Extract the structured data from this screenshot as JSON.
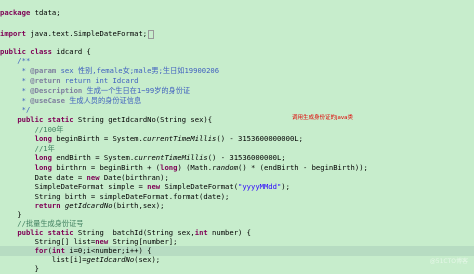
{
  "code": {
    "l01_kw": "package",
    "l01_rest": " tdata;",
    "l03_kw": "import",
    "l03_rest": " java.text.SimpleDateFormat;",
    "l05_kw1": "public",
    "l05_kw2": "class",
    "l05_rest": " idcard {",
    "l06": "    /**",
    "l07_star": "     * ",
    "l07_tag": "@param",
    "l07_text": " sex 性别,female女;male男;生日如19900206",
    "l08_star": "     * ",
    "l08_tag": "@return",
    "l08_text": " return int Idcard",
    "l09_star": "     * ",
    "l09_tag": "@Description",
    "l09_text": " 生成一个生日在1~99岁的身份证",
    "l10_star": "     * ",
    "l10_tag": "@useCase",
    "l10_text": " 生成人员的身份证信息",
    "l11": "     */",
    "l12_indent": "    ",
    "l12_kw1": "public",
    "l12_kw2": "static",
    "l12_rest": " String getIdcardNo(String sex){",
    "l13": "        //100年",
    "l14_indent": "        ",
    "l14_kw": "long",
    "l14_a": " beginBirth = System.",
    "l14_it": "currentTimeMillis",
    "l14_b": "() - 3153600000000L;",
    "l15": "        //1年",
    "l16_indent": "        ",
    "l16_kw": "long",
    "l16_a": " endBirth = System.",
    "l16_it": "currentTimeMillis",
    "l16_b": "() - 31536000000L;",
    "l17_indent": "        ",
    "l17_kw1": "long",
    "l17_a": " birthrn = beginBirth + (",
    "l17_kw2": "long",
    "l17_b": ") (Math.",
    "l17_it": "random",
    "l17_c": "() * (endBirth - beginBirth));",
    "l18_a": "        Date date = ",
    "l18_kw": "new",
    "l18_b": " Date(birthran);",
    "l19_a": "        SimpleDateFormat simple = ",
    "l19_kw": "new",
    "l19_b": " SimpleDateFormat(",
    "l19_str": "\"yyyyMMdd\"",
    "l19_c": ");",
    "l20": "        String birth = simpleDateFormat.format(date);",
    "l21_a": "        ",
    "l21_kw": "return",
    "l21_b": " ",
    "l21_it": "getIdcardNo",
    "l21_c": "(birth,sex);",
    "l22": "    }",
    "l23": "    //批量生成身份证号",
    "l24_indent": "    ",
    "l24_kw1": "public",
    "l24_kw2": "static",
    "l24_a": " String  batchId(String sex,",
    "l24_kw3": "int",
    "l24_b": " number) {",
    "l25_a": "        String[] list=",
    "l25_kw": "new",
    "l25_b": " String[number];",
    "l26_a": "        ",
    "l26_kw1": "for",
    "l26_b": "(",
    "l26_kw2": "int",
    "l26_c": " i=0;i<number;i++) {",
    "l27_a": "            list[i]=",
    "l27_it": "getIdcardNo",
    "l27_b": "(sex);",
    "l28": "        }"
  },
  "annotation": "调用生成身份证的java类",
  "watermark": "@51CTO博客"
}
